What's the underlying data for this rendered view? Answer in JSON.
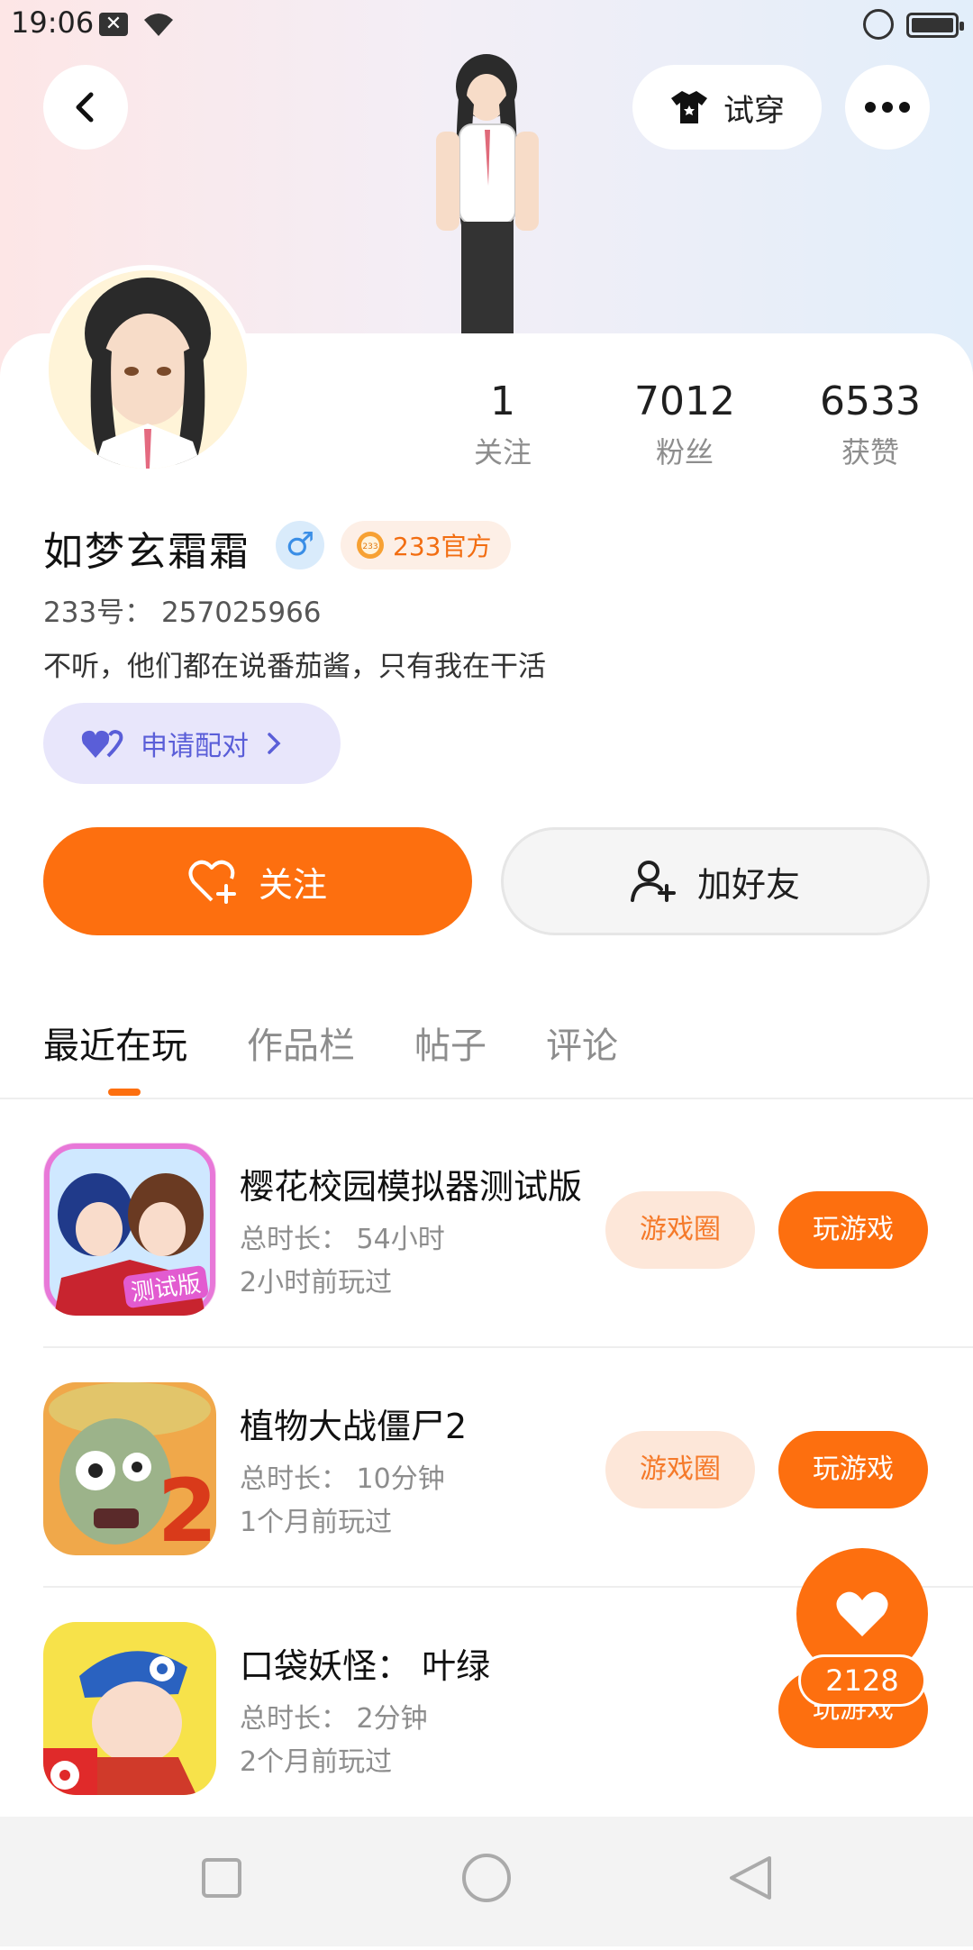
{
  "status_bar": {
    "time": "19:06"
  },
  "header": {
    "tryon_label": "试穿"
  },
  "profile": {
    "name": "如梦玄霜霜",
    "gender_symbol": "♂",
    "official_badge": "233官方",
    "uid": "233号： 257025966",
    "bio": "不听，他们都在说番茄酱，只有我在干活",
    "pair_label": "申请配对"
  },
  "stats": [
    {
      "value": "1",
      "label": "关注"
    },
    {
      "value": "7012",
      "label": "粉丝"
    },
    {
      "value": "6533",
      "label": "获赞"
    }
  ],
  "actions": {
    "follow_label": "关注",
    "add_friend_label": "加好友"
  },
  "tabs": [
    "最近在玩",
    "作品栏",
    "帖子",
    "评论"
  ],
  "games": [
    {
      "title": "樱花校园模拟器测试版",
      "duration": "总时长： 54小时",
      "last_played": "2小时前玩过",
      "circle_label": "游戏圈",
      "play_label": "玩游戏",
      "icon_text": "测试版"
    },
    {
      "title": "植物大战僵尸2",
      "duration": "总时长： 10分钟",
      "last_played": "1个月前玩过",
      "circle_label": "游戏圈",
      "play_label": "玩游戏",
      "icon_text": "2"
    },
    {
      "title": "口袋妖怪： 叶绿",
      "duration": "总时长： 2分钟",
      "last_played": "2个月前玩过",
      "play_label": "玩游戏"
    }
  ],
  "like_count": "2128",
  "colors": {
    "accent": "#fd6f0f",
    "pair": "#5a5ed8",
    "official": "#f26d11"
  }
}
